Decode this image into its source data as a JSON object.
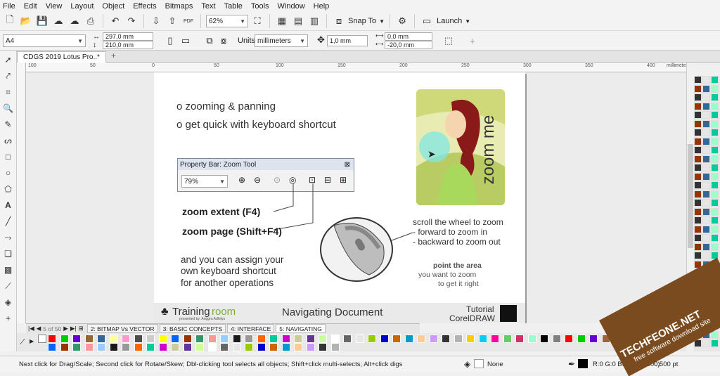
{
  "menu": [
    "File",
    "Edit",
    "View",
    "Layout",
    "Object",
    "Effects",
    "Bitmaps",
    "Text",
    "Table",
    "Tools",
    "Window",
    "Help"
  ],
  "toolbar": {
    "zoom_value": "62%",
    "snap_label": "Snap To",
    "launch_label": "Launch"
  },
  "propbar": {
    "page_size": "A4",
    "width": "297,0 mm",
    "height": "210,0 mm",
    "units_label": "Units:",
    "units_value": "millimeters",
    "nudge": "1,0 mm",
    "dup_x": "0,0 mm",
    "dup_y": "-20,0 mm"
  },
  "document": {
    "tab_title": "CDGS 2019 Lotus Pro..*"
  },
  "ruler": {
    "unit": "millimeters",
    "ticks": [
      "100",
      "50",
      "0",
      "50",
      "100",
      "150",
      "200",
      "250",
      "300",
      "350",
      "400"
    ]
  },
  "slide": {
    "bullet1": "o zooming & panning",
    "bullet2": "o get quick with keyboard shortcut",
    "zoomtool_title": "Property Bar: Zoom Tool",
    "zoomtool_value": "79%",
    "zoom_extent": "zoom extent (F4)",
    "zoom_page": "zoom page (Shift+F4)",
    "assign_1": "and you can assign your",
    "assign_2": "own keyboard shortcut",
    "assign_3": "for another operations",
    "scroll_1": "scroll the wheel to zoom",
    "scroll_2": "- forward to zoom in",
    "scroll_3": "- backward to zoom out",
    "point_1": "point the area",
    "point_2": "you want to zoom",
    "point_3": "to get it right",
    "card_text": "zoom me",
    "brand": "Training",
    "brand_suffix": "room",
    "brand_sub": "presented by: Anggra Adhityo",
    "footer_title": "Navigating Document",
    "tutorial": "Tutorial",
    "coreldraw": "CorelDRAW"
  },
  "pagetabs": {
    "counter": "5 of 50",
    "tabs": [
      "2: BITMAP Vs VECTOR",
      "3: BASIC CONCEPTS",
      "4: INTERFACE",
      "5: NAVIGATING"
    ]
  },
  "status": {
    "hint": "Next click for Drag/Scale; Second click for Rotate/Skew; Dbl-clicking tool selects all objects; Shift+click multi-selects; Alt+click digs",
    "fill": "None",
    "outline_color": "R:0 G:0 B:0 (#000000)",
    "outline_width": "0,500 pt"
  },
  "watermark": {
    "site": "TECHFEONE.NET",
    "tagline": "free software download site"
  },
  "palette_colors": [
    "#ffffff",
    "#000000",
    "#1a1a1a",
    "#333333",
    "#4d4d4d",
    "#666666",
    "#808080",
    "#999999",
    "#b3b3b3",
    "#cccccc",
    "#e6e6e6",
    "#ff0000",
    "#ff6600",
    "#ffcc00",
    "#ffff00",
    "#99cc00",
    "#00cc00",
    "#00cc99",
    "#00ccff",
    "#0066ff",
    "#0000cc",
    "#6600cc",
    "#cc00cc",
    "#ff0099",
    "#993300",
    "#cc6600",
    "#996633",
    "#cccc99",
    "#66cc66",
    "#339966",
    "#0099cc",
    "#336699",
    "#663399",
    "#cc3366",
    "#ff9999",
    "#ffcc99",
    "#ffff99",
    "#ccff99",
    "#99ffcc",
    "#99ccff",
    "#cc99ff",
    "#ff99cc"
  ]
}
